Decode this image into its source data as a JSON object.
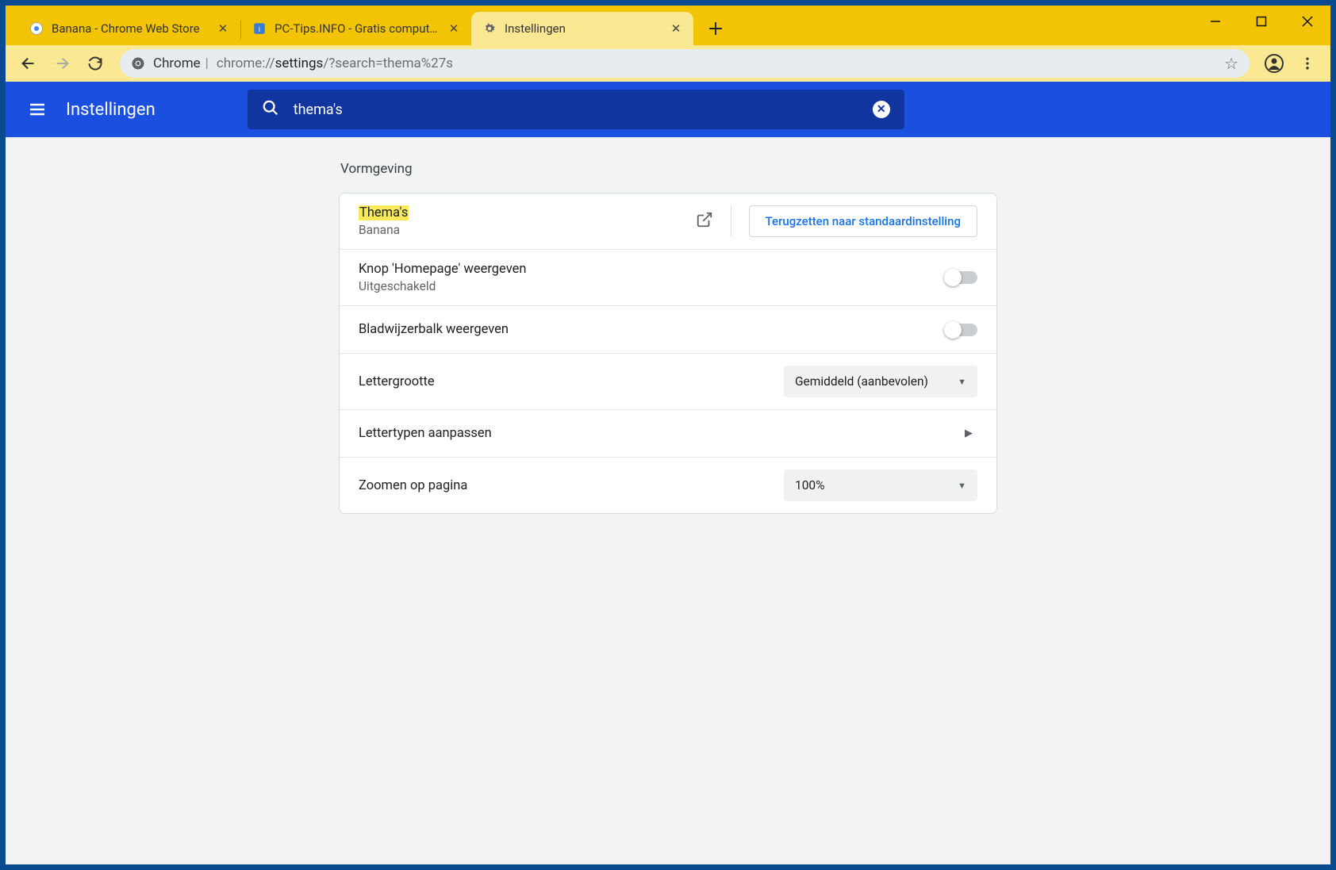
{
  "window": {
    "tabs": [
      {
        "title": "Banana - Chrome Web Store",
        "active": false
      },
      {
        "title": "PC-Tips.INFO - Gratis computer t",
        "active": false
      },
      {
        "title": "Instellingen",
        "active": true
      }
    ]
  },
  "toolbar": {
    "url_scheme_label": "Chrome",
    "url_base": "chrome://",
    "url_bold": "settings",
    "url_rest": "/?search=thema%27s"
  },
  "header": {
    "title": "Instellingen",
    "search_value": "thema's"
  },
  "section": {
    "title": "Vormgeving"
  },
  "rows": {
    "themes": {
      "label": "Thema's",
      "sub": "Banana",
      "reset_label": "Terugzetten naar standaardinstelling"
    },
    "homepage": {
      "label": "Knop 'Homepage' weergeven",
      "sub": "Uitgeschakeld"
    },
    "bookmarks": {
      "label": "Bladwijzerbalk weergeven"
    },
    "fontsize": {
      "label": "Lettergrootte",
      "value": "Gemiddeld (aanbevolen)"
    },
    "customfonts": {
      "label": "Lettertypen aanpassen"
    },
    "zoom": {
      "label": "Zoomen op pagina",
      "value": "100%"
    }
  }
}
